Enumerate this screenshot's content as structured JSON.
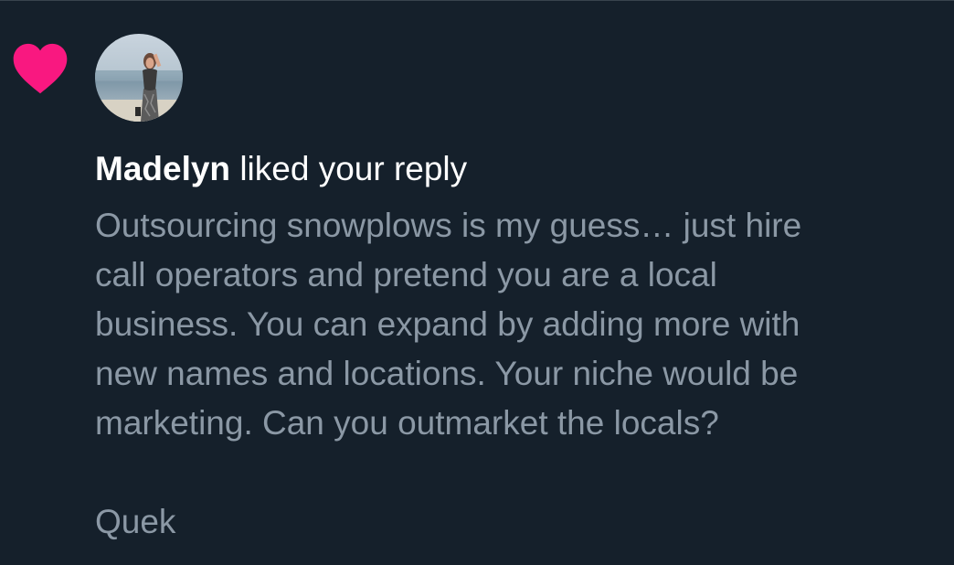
{
  "notification": {
    "icon": "heart-icon",
    "heart_color": "#f91880",
    "user_name": "Madelyn",
    "action_text": " liked your reply",
    "reply_lines": [
      "Outsourcing snowplows is my guess… just hire",
      "call operators and pretend you are a local",
      "business. You can expand by adding more with",
      "new names and locations. Your niche would be",
      "marketing. Can you outmarket the locals?"
    ],
    "signature": "Quek"
  },
  "colors": {
    "background": "#15202b",
    "primary_text": "#ffffff",
    "secondary_text": "#8b98a5"
  }
}
